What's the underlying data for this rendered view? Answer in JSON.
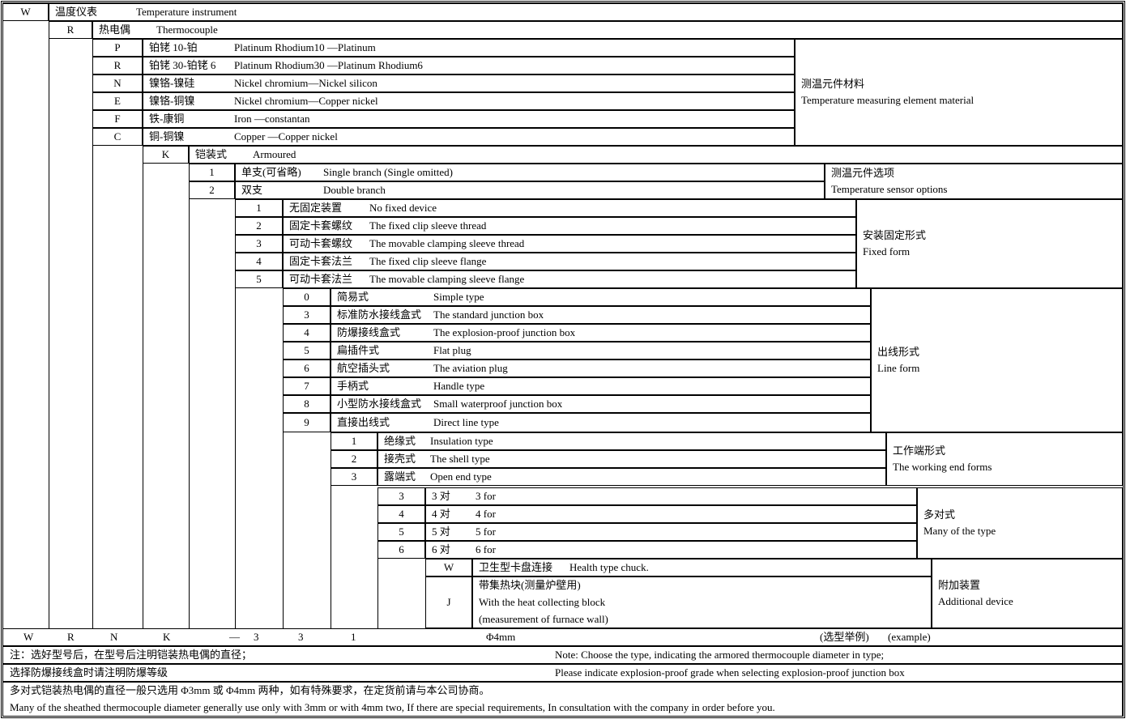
{
  "sections": [
    {
      "rows": [
        {
          "code": "W",
          "zh": "温度仪表",
          "en": "Temperature instrument"
        }
      ]
    },
    {
      "rows": [
        {
          "code": "R",
          "zh": "热电偶",
          "en": "Thermocouple"
        }
      ]
    },
    {
      "rows": [
        {
          "code": "P",
          "zh": "铂铑 10-铂",
          "en": "Platinum Rhodium10 —Platinum"
        },
        {
          "code": "R",
          "zh": "铂铑 30-铂铑 6",
          "en": "Platinum Rhodium30 —Platinum Rhodium6"
        },
        {
          "code": "N",
          "zh": "镍铬-镍硅",
          "en": "Nickel chromium—Nickel silicon"
        },
        {
          "code": "E",
          "zh": "镍铬-铜镍",
          "en": "Nickel chromium—Copper nickel"
        },
        {
          "code": "F",
          "zh": "铁-康铜",
          "en": "Iron —constantan"
        },
        {
          "code": "C",
          "zh": "铜-铜镍",
          "en": "Copper —Copper nickel"
        }
      ],
      "label": {
        "zh": "测温元件材料",
        "en": "Temperature measuring element material"
      }
    },
    {
      "rows": [
        {
          "code": "K",
          "zh": "铠装式",
          "en": "Armoured"
        }
      ]
    },
    {
      "rows": [
        {
          "code": "1",
          "zh": "单支(可省略)",
          "en": "Single branch (Single omitted)"
        },
        {
          "code": "2",
          "zh": "双支",
          "en": "Double branch"
        }
      ],
      "label": {
        "zh": "测温元件选项",
        "en": "Temperature sensor options"
      }
    },
    {
      "rows": [
        {
          "code": "1",
          "zh": "无固定装置",
          "en": "No fixed device"
        },
        {
          "code": "2",
          "zh": "固定卡套螺纹",
          "en": "The fixed clip sleeve thread"
        },
        {
          "code": "3",
          "zh": "可动卡套螺纹",
          "en": "The movable clamping sleeve thread"
        },
        {
          "code": "4",
          "zh": "固定卡套法兰",
          "en": "The fixed clip sleeve flange"
        },
        {
          "code": "5",
          "zh": "可动卡套法兰",
          "en": "The movable clamping sleeve flange"
        }
      ],
      "label": {
        "zh": "安装固定形式",
        "en": "Fixed form"
      }
    },
    {
      "rows": [
        {
          "code": "0",
          "zh": "简易式",
          "en": "Simple type"
        },
        {
          "code": "3",
          "zh": "标准防水接线盒式",
          "en": "The standard junction box"
        },
        {
          "code": "4",
          "zh": "防爆接线盒式",
          "en": "The explosion-proof junction box"
        },
        {
          "code": "5",
          "zh": "扁插件式",
          "en": "Flat plug"
        },
        {
          "code": "6",
          "zh": "航空插头式",
          "en": "The aviation plug"
        },
        {
          "code": "7",
          "zh": "手柄式",
          "en": "Handle type"
        },
        {
          "code": "8",
          "zh": "小型防水接线盒式",
          "en": "Small waterproof junction box"
        },
        {
          "code": "9",
          "zh": "直接出线式",
          "en": "Direct line type"
        }
      ],
      "label": {
        "zh": "出线形式",
        "en": "Line form"
      }
    },
    {
      "rows": [
        {
          "code": "1",
          "zh": "绝缘式",
          "en": "Insulation type"
        },
        {
          "code": "2",
          "zh": "接壳式",
          "en": "The shell type"
        },
        {
          "code": "3",
          "zh": "露端式",
          "en": "Open end type"
        }
      ],
      "label": {
        "zh": "工作端形式",
        "en": "The working end forms"
      }
    },
    {
      "rows": [
        {
          "code": "3",
          "zh": "3 对",
          "en": "3 for"
        },
        {
          "code": "4",
          "zh": "4 对",
          "en": "4 for"
        },
        {
          "code": "5",
          "zh": "5 对",
          "en": "5 for"
        },
        {
          "code": "6",
          "zh": "6 对",
          "en": "6 for"
        }
      ],
      "label": {
        "zh": "多对式",
        "en": "Many of the type"
      }
    },
    {
      "rows": [
        {
          "code": "W",
          "zh": "卫生型卡盘连接",
          "en": "Health type chuck."
        },
        {
          "code": "J",
          "zh": "带集热块(测量炉壁用)",
          "en": "With the heat collecting block",
          "en2": "(measurement of furnace wall)"
        }
      ],
      "label": {
        "zh": "附加装置",
        "en": "Additional device"
      }
    }
  ],
  "example": {
    "codes": [
      "W",
      "R",
      "N",
      "K",
      "—",
      "3",
      "3",
      "1"
    ],
    "diameter": "Φ4mm",
    "zh": "(选型举例)",
    "en": "(example)"
  },
  "notes": [
    {
      "zh": "注：选好型号后，在型号后注明铠装热电偶的直径；",
      "en": "Note: Choose the type, indicating the armored thermocouple diameter in type;"
    },
    {
      "zh": "选择防爆接线盒时请注明防爆等级",
      "en": "Please indicate explosion-proof grade when selecting explosion-proof junction box"
    },
    {
      "zh": "多对式铠装热电偶的直径一般只选用 Φ3mm 或 Φ4mm 两种，如有特殊要求，在定货前请与本公司协商。",
      "en": "Many of the sheathed thermocouple diameter generally use only with 3mm or with 4mm two, If there are special requirements, In consultation with the company in order before you."
    }
  ]
}
